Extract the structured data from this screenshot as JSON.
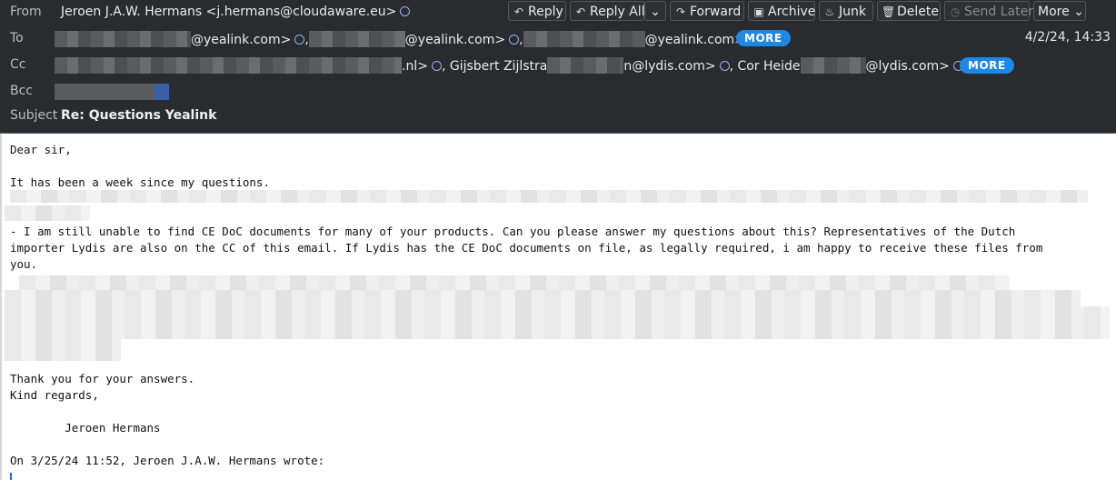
{
  "header": {
    "from_label": "From",
    "from_value": "Jeroen J.A.W. Hermans <j.hermans@cloudaware.eu>",
    "to_label": "To",
    "to_parts": [
      "@yealink.com>",
      "@yealink.com>",
      "@yealink.com>"
    ],
    "cc_label": "Cc",
    "cc_part1": ".nl>",
    "cc_part2": ", Gijsbert Zijlstra",
    "cc_part3": "n@lydis.com>",
    "cc_part4": ", Cor Heide",
    "cc_part5": "@lydis.com>",
    "bcc_label": "Bcc",
    "subject_label": "Subject",
    "subject": "Re: Questions Yealink",
    "date": "4/2/24, 14:33",
    "more_label": "MORE"
  },
  "toolbar": {
    "reply": "Reply",
    "reply_all": "Reply All",
    "forward": "Forward",
    "archive": "Archive",
    "junk": "Junk",
    "delete": "Delete",
    "send_later": "Send Later",
    "more": "More"
  },
  "body": {
    "line1": "Dear sir,",
    "line2": "It has been a week since my questions.",
    "para1a": "- I am still unable to find CE DoC documents for many of your products. Can you please answer my questions about this? Representatives of the Dutch",
    "para1b": "importer Lydis are also on the CC of this email. If Lydis has the CE DoC documents on file, as legally required, i am happy to receive these files from",
    "para1c": "you.",
    "thanks": "Thank you for your answers.",
    "regards": "Kind regards,",
    "signature": "        Jeroen Hermans",
    "quote": "On 3/25/24 11:52, Jeroen J.A.W. Hermans wrote:"
  }
}
